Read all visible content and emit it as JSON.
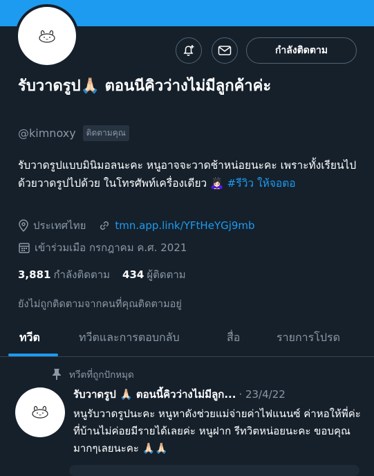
{
  "profile": {
    "display_name": "รับวาดรูป🙏🏻 ตอนนีคิวว่างไม่มีลูกค้าค่ะ",
    "handle": "@kimnoxy",
    "follows_you": "ติดตามคุณ",
    "bio_text": "รับวาดรูปแบบมินิมอลนะคะ หนูอาจจะวาดช้าหน่อยนะคะ เพราะทั้งเรียนไปด้วยวาดรูปไปด้วย ในโทรศัพท์เครื่องเดียว 🙇🏻‍♀️",
    "bio_hashtag": "#รีวิว ให้จอตอ",
    "location": "ประเทศไทย",
    "website": "tmn.app.link/YFtHeYGj9mb",
    "joined": "เข้าร่วมเมือ กรกฎาคม ค.ศ. 2021",
    "following_count": "3,881",
    "following_label": "กำลังติดตาม",
    "followers_count": "434",
    "followers_label": "ผู้ติดตาม",
    "not_followed_note": "ยังไม่ถูกติดตามจากคนที่คุณติดตามอยู่"
  },
  "actions": {
    "follow_button": "กำลังติดตาม",
    "notify_icon": "bell-plus-icon",
    "message_icon": "envelope-icon"
  },
  "tabs": [
    {
      "label": "ทวีต",
      "active": true
    },
    {
      "label": "ทวีตและการตอบกลับ",
      "active": false
    },
    {
      "label": "สื่อ",
      "active": false
    },
    {
      "label": "รายการโปรด",
      "active": false
    }
  ],
  "pinned_tweet": {
    "pinned_label": "ทวีตที่ถูกปักหมุด",
    "author": "รับวาดรูป 🙏🏻 ตอนนี้คิวว่างไม่มีลูก...",
    "date": "· 23/4/22",
    "text": "หนูรับวาดรูปนะคะ หนูหาดังช่วยแม่จ่ายค่าไฟแนนซ์ ค่าหอให้พี่ค่ะ ที่บ้านไม่ค่อยมีรายได้เลยค่ะ หนูฝาก รีทวิตหน่อยนะคะ ขอบคุณมากๆเลยนะคะ 🙏🏻🙏🏻"
  },
  "colors": {
    "background": "#15202b",
    "accent": "#1d9bf0",
    "secondary_text": "#8b98a5"
  }
}
